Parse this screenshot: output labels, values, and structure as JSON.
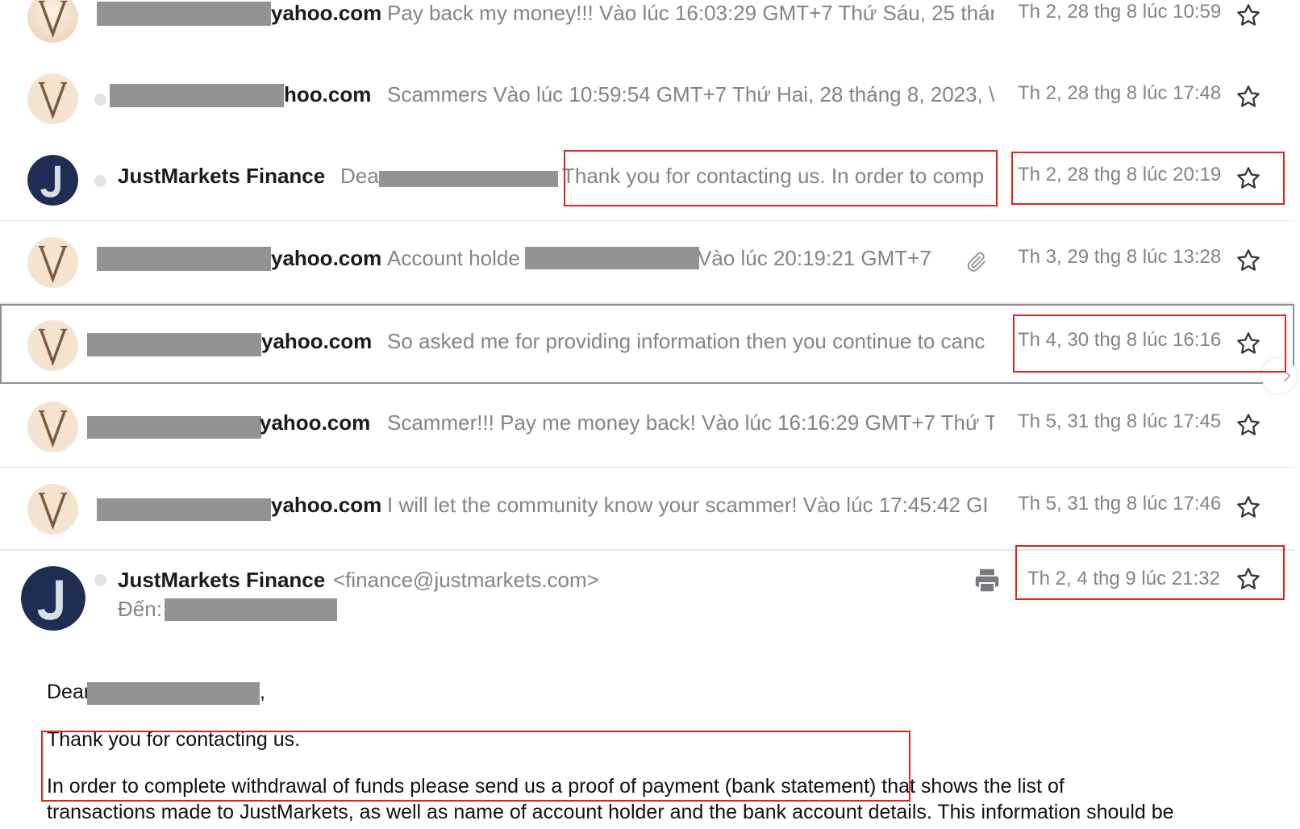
{
  "colors": {
    "highlight": "#e2231a",
    "redaction": "#939393",
    "meta_text": "#83838a"
  },
  "threads": [
    {
      "avatar": "V",
      "sender": "yahoo.com",
      "preview": "Pay back my money!!! Vào lúc 16:03:29 GMT+7 Thứ Sáu, 25 thán",
      "date": "Th 2, 28 thg 8 lúc 10:59"
    },
    {
      "avatar": "V",
      "sender": "hoo.com",
      "preview": "Scammers Vào lúc 10:59:54 GMT+7 Thứ Hai, 28 tháng 8, 2023, \\",
      "date": "Th 2, 28 thg 8 lúc 17:48"
    },
    {
      "avatar": "J",
      "sender": "JustMarkets Finance",
      "preview_start": "Dea",
      "preview": "Thank you for contacting us. In order to comp",
      "date": "Th 2, 28 thg 8 lúc 20:19"
    },
    {
      "avatar": "V",
      "sender": "yahoo.com",
      "preview_start": "Account holde",
      "preview": "Vào lúc 20:19:21 GMT+7 ¯",
      "date": "Th 3, 29 thg 8 lúc 13:28"
    },
    {
      "avatar": "V",
      "sender": "yahoo.com",
      "preview": "So asked me for providing information then you continue to canc",
      "date": "Th 4, 30 thg 8 lúc 16:16"
    },
    {
      "avatar": "V",
      "sender": "yahoo.com",
      "preview": "Scammer!!! Pay me money back! Vào lúc 16:16:29 GMT+7 Thứ T",
      "date": "Th 5, 31 thg 8 lúc 17:45"
    },
    {
      "avatar": "V",
      "sender": "yahoo.com",
      "preview": "I will let the community know your scammer! Vào lúc 17:45:42 GI",
      "date": "Th 5, 31 thg 8 lúc 17:46"
    }
  ],
  "open_message": {
    "avatar": "J",
    "sender_name": "JustMarkets Finance",
    "sender_email": "<finance@justmarkets.com>",
    "to_label": "Đến:",
    "date": "Th 2, 4 thg 9 lúc 21:32",
    "greeting": "Dear",
    "greeting_end": ",",
    "line1": "Thank you for contacting us.",
    "line2": "In order to complete withdrawal of funds please send us a proof of payment (bank statement) that shows the list of",
    "line3": "transactions made to JustMarkets, as well as name of account holder and the bank account details. This information should be"
  }
}
